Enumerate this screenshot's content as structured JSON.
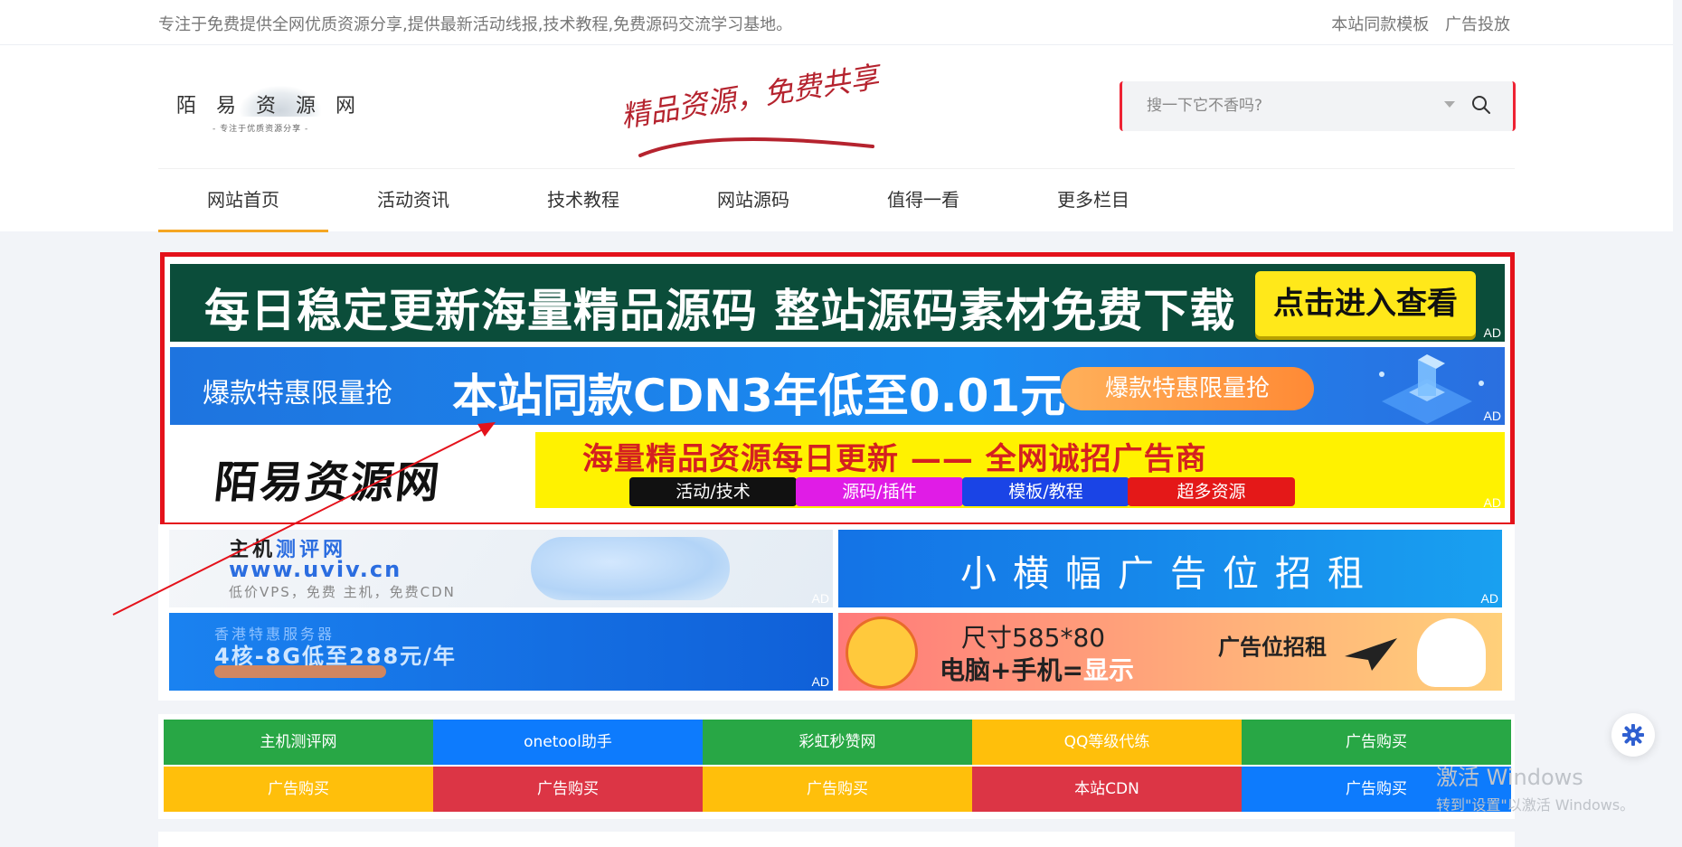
{
  "topbar": {
    "tagline": "专注于免费提供全网优质资源分享,提供最新活动线报,技术教程,免费源码交流学习基地。",
    "links": [
      "本站同款模板",
      "广告投放"
    ]
  },
  "header": {
    "logo": {
      "title": "陌易资源网",
      "subtitle": "- 专注于优质资源分享 -"
    },
    "slogan": "精品资源，免费共享",
    "search": {
      "placeholder": "搜一下它不香吗?"
    }
  },
  "nav": {
    "items": [
      "网站首页",
      "活动资讯",
      "技术教程",
      "网站源码",
      "值得一看",
      "更多栏目"
    ],
    "active_index": 0
  },
  "ads": {
    "label": "AD",
    "banner1": {
      "text": "每日稳定更新海量精品源码    整站源码素材免费下载",
      "button": "点击进入查看"
    },
    "banner2": {
      "left": "爆款特惠限量抢",
      "main": "本站同款CDN3年低至0.01元",
      "pill": "爆款特惠限量抢"
    },
    "banner3": {
      "name": "陌易资源网",
      "headline": "海量精品资源每日更新 —— 全网诚招广告商",
      "tags": [
        {
          "text": "活动/技术",
          "color": "#111111"
        },
        {
          "text": "源码/插件",
          "color": "#e01ce6"
        },
        {
          "text": "模板/教程",
          "color": "#1a44e6"
        },
        {
          "text": "超多资源",
          "color": "#e41818"
        }
      ]
    },
    "small": {
      "host": {
        "line1": "主机",
        "line1b": "测评网",
        "line2": "www.uviv.cn",
        "line3": "低价VPS，免费 主机，免费CDN"
      },
      "rent": "小横幅广告位招租",
      "server": {
        "line1": "香港特惠服务器",
        "line2": "4核-8G低至288元/年"
      },
      "size": {
        "line1": "尺寸585*80",
        "line2a": "电脑+手机=",
        "line2b": "显示",
        "line3": "广告位招租"
      }
    }
  },
  "links": [
    {
      "text": "主机测评网",
      "color": "#28a745"
    },
    {
      "text": "onetool助手",
      "color": "#0d7bfd"
    },
    {
      "text": "彩虹秒赞网",
      "color": "#28a745"
    },
    {
      "text": "QQ等级代练",
      "color": "#ffbf0b"
    },
    {
      "text": "广告购买",
      "color": "#28a745"
    },
    {
      "text": "广告购买",
      "color": "#ffbf0b"
    },
    {
      "text": "广告购买",
      "color": "#dc3545"
    },
    {
      "text": "广告购买",
      "color": "#ffbf0b"
    },
    {
      "text": "本站CDN",
      "color": "#dc3545"
    },
    {
      "text": "广告购买",
      "color": "#0d7bfd"
    }
  ],
  "watermark": {
    "line1": "激活 Windows",
    "line2": "转到\"设置\"以激活 Windows。"
  },
  "icons": {
    "search": "search-icon",
    "settings": "gear-icon",
    "dropdown": "caret-down-icon"
  },
  "colors": {
    "accent": "#f5a623",
    "ad_border": "#e4121b"
  }
}
